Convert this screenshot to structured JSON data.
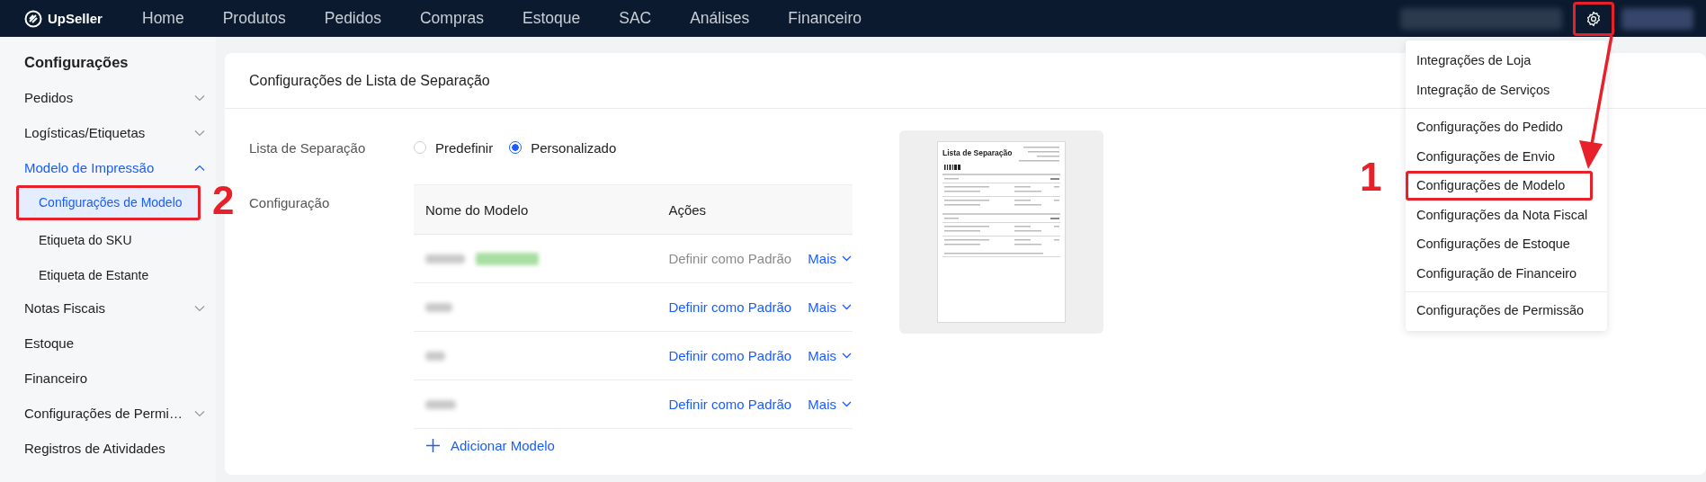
{
  "topbar": {
    "logo": "UpSeller",
    "nav": [
      {
        "label": "Home"
      },
      {
        "label": "Produtos"
      },
      {
        "label": "Pedidos"
      },
      {
        "label": "Compras"
      },
      {
        "label": "Estoque"
      },
      {
        "label": "SAC"
      },
      {
        "label": "Análises"
      },
      {
        "label": "Financeiro"
      }
    ],
    "settings_highlighted": true
  },
  "sidebar": {
    "title": "Configurações",
    "items": [
      {
        "label": "Pedidos",
        "kind": "group",
        "expanded": false,
        "selected": false
      },
      {
        "label": "Logísticas/Etiquetas",
        "kind": "group",
        "expanded": false,
        "selected": false
      },
      {
        "label": "Modelo de Impressão",
        "kind": "group",
        "expanded": true,
        "selected": true,
        "children": [
          {
            "label": "Configurações de Modelo",
            "selected": true,
            "highlighted": true
          },
          {
            "label": "Etiqueta do SKU",
            "selected": false,
            "highlighted": false
          },
          {
            "label": "Etiqueta de Estante",
            "selected": false,
            "highlighted": false
          }
        ]
      },
      {
        "label": "Notas Fiscais",
        "kind": "group",
        "expanded": false,
        "selected": false
      },
      {
        "label": "Estoque",
        "kind": "link",
        "selected": false
      },
      {
        "label": "Financeiro",
        "kind": "link",
        "selected": false
      },
      {
        "label": "Configurações de Permi…",
        "kind": "group",
        "expanded": false,
        "selected": false
      },
      {
        "label": "Registros de Atividades",
        "kind": "link",
        "selected": false
      }
    ]
  },
  "panel": {
    "title": "Configurações de Lista de Separação",
    "mode_label": "Lista de Separação",
    "options": [
      {
        "label": "Predefinir",
        "selected": false
      },
      {
        "label": "Personalizado",
        "selected": true
      }
    ],
    "config_label": "Configuração",
    "table": {
      "columns": [
        "Nome do Modelo",
        "Ações"
      ],
      "rows": [
        {
          "default": true,
          "action": "Definir como Padrão",
          "more": "Mais"
        },
        {
          "default": false,
          "action": "Definir como Padrão",
          "more": "Mais"
        },
        {
          "default": false,
          "action": "Definir como Padrão",
          "more": "Mais"
        },
        {
          "default": false,
          "action": "Definir como Padrão",
          "more": "Mais"
        }
      ]
    },
    "add_label": "Adicionar Modelo",
    "preview": {
      "title": "Lista de Separação"
    }
  },
  "settings_menu": {
    "groups": [
      [
        {
          "label": "Integrações de Loja",
          "highlighted": false
        },
        {
          "label": "Integração de Serviços",
          "highlighted": false
        }
      ],
      [
        {
          "label": "Configurações do Pedido",
          "highlighted": false
        },
        {
          "label": "Configurações de Envio",
          "highlighted": false
        },
        {
          "label": "Configurações de Modelo",
          "highlighted": true
        },
        {
          "label": "Configurações da Nota Fiscal",
          "highlighted": false
        },
        {
          "label": "Configurações de Estoque",
          "highlighted": false
        },
        {
          "label": "Configuração de Financeiro",
          "highlighted": false
        }
      ],
      [
        {
          "label": "Configurações de Permissão",
          "highlighted": false
        }
      ]
    ]
  },
  "annotations": [
    {
      "label": "1"
    },
    {
      "label": "2"
    }
  ]
}
